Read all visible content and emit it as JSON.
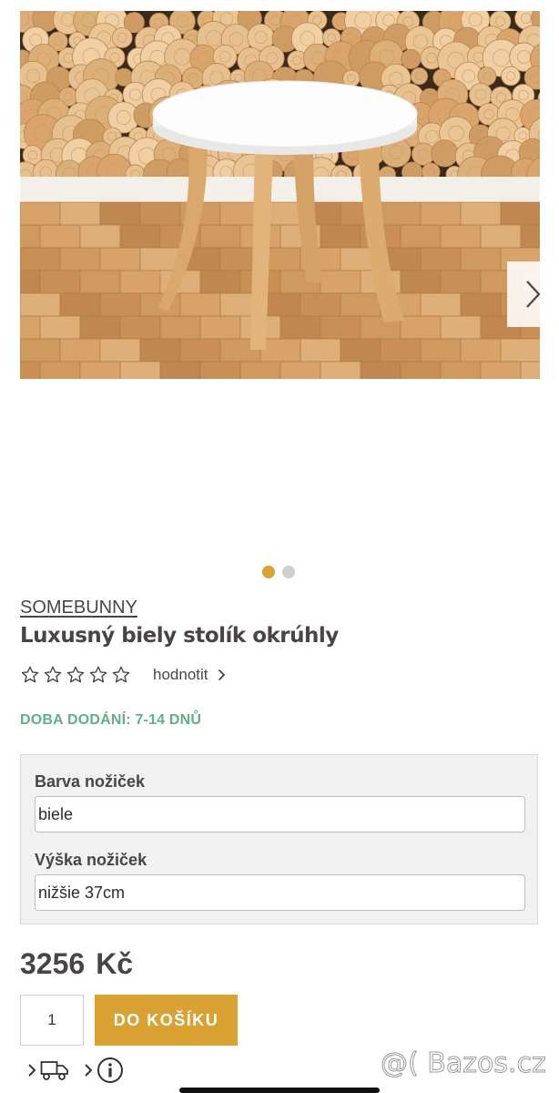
{
  "gallery": {
    "next_icon": "chevron-right-icon",
    "dots": [
      true,
      false
    ],
    "colors": {
      "dot_active": "#d9a233",
      "dot_inactive": "#cfcfcf"
    }
  },
  "product": {
    "brand": "SOMEBUNNY",
    "title": "Luxusný biely stolík okrúhly",
    "rating_stars": 0,
    "rating_max": 5,
    "rate_label": "hodnotit",
    "delivery": "DOBA DODÁNÍ: 7-14 DNŮ",
    "options": [
      {
        "label": "Barva nožiček",
        "value": "biele"
      },
      {
        "label": "Výška nožiček",
        "value": "nižšie 37cm"
      }
    ],
    "price": "3256",
    "currency": "Kč",
    "quantity": "1",
    "cart_button": "DO KOŠÍKU"
  },
  "footer_icons": [
    "chevron-right-icon",
    "delivery-truck-icon",
    "chevron-right-icon",
    "info-icon"
  ],
  "watermark": "@( Bazos.cz",
  "colors": {
    "accent": "#d9a233",
    "delivery_green": "#5fb08a",
    "text": "#4a4545"
  }
}
